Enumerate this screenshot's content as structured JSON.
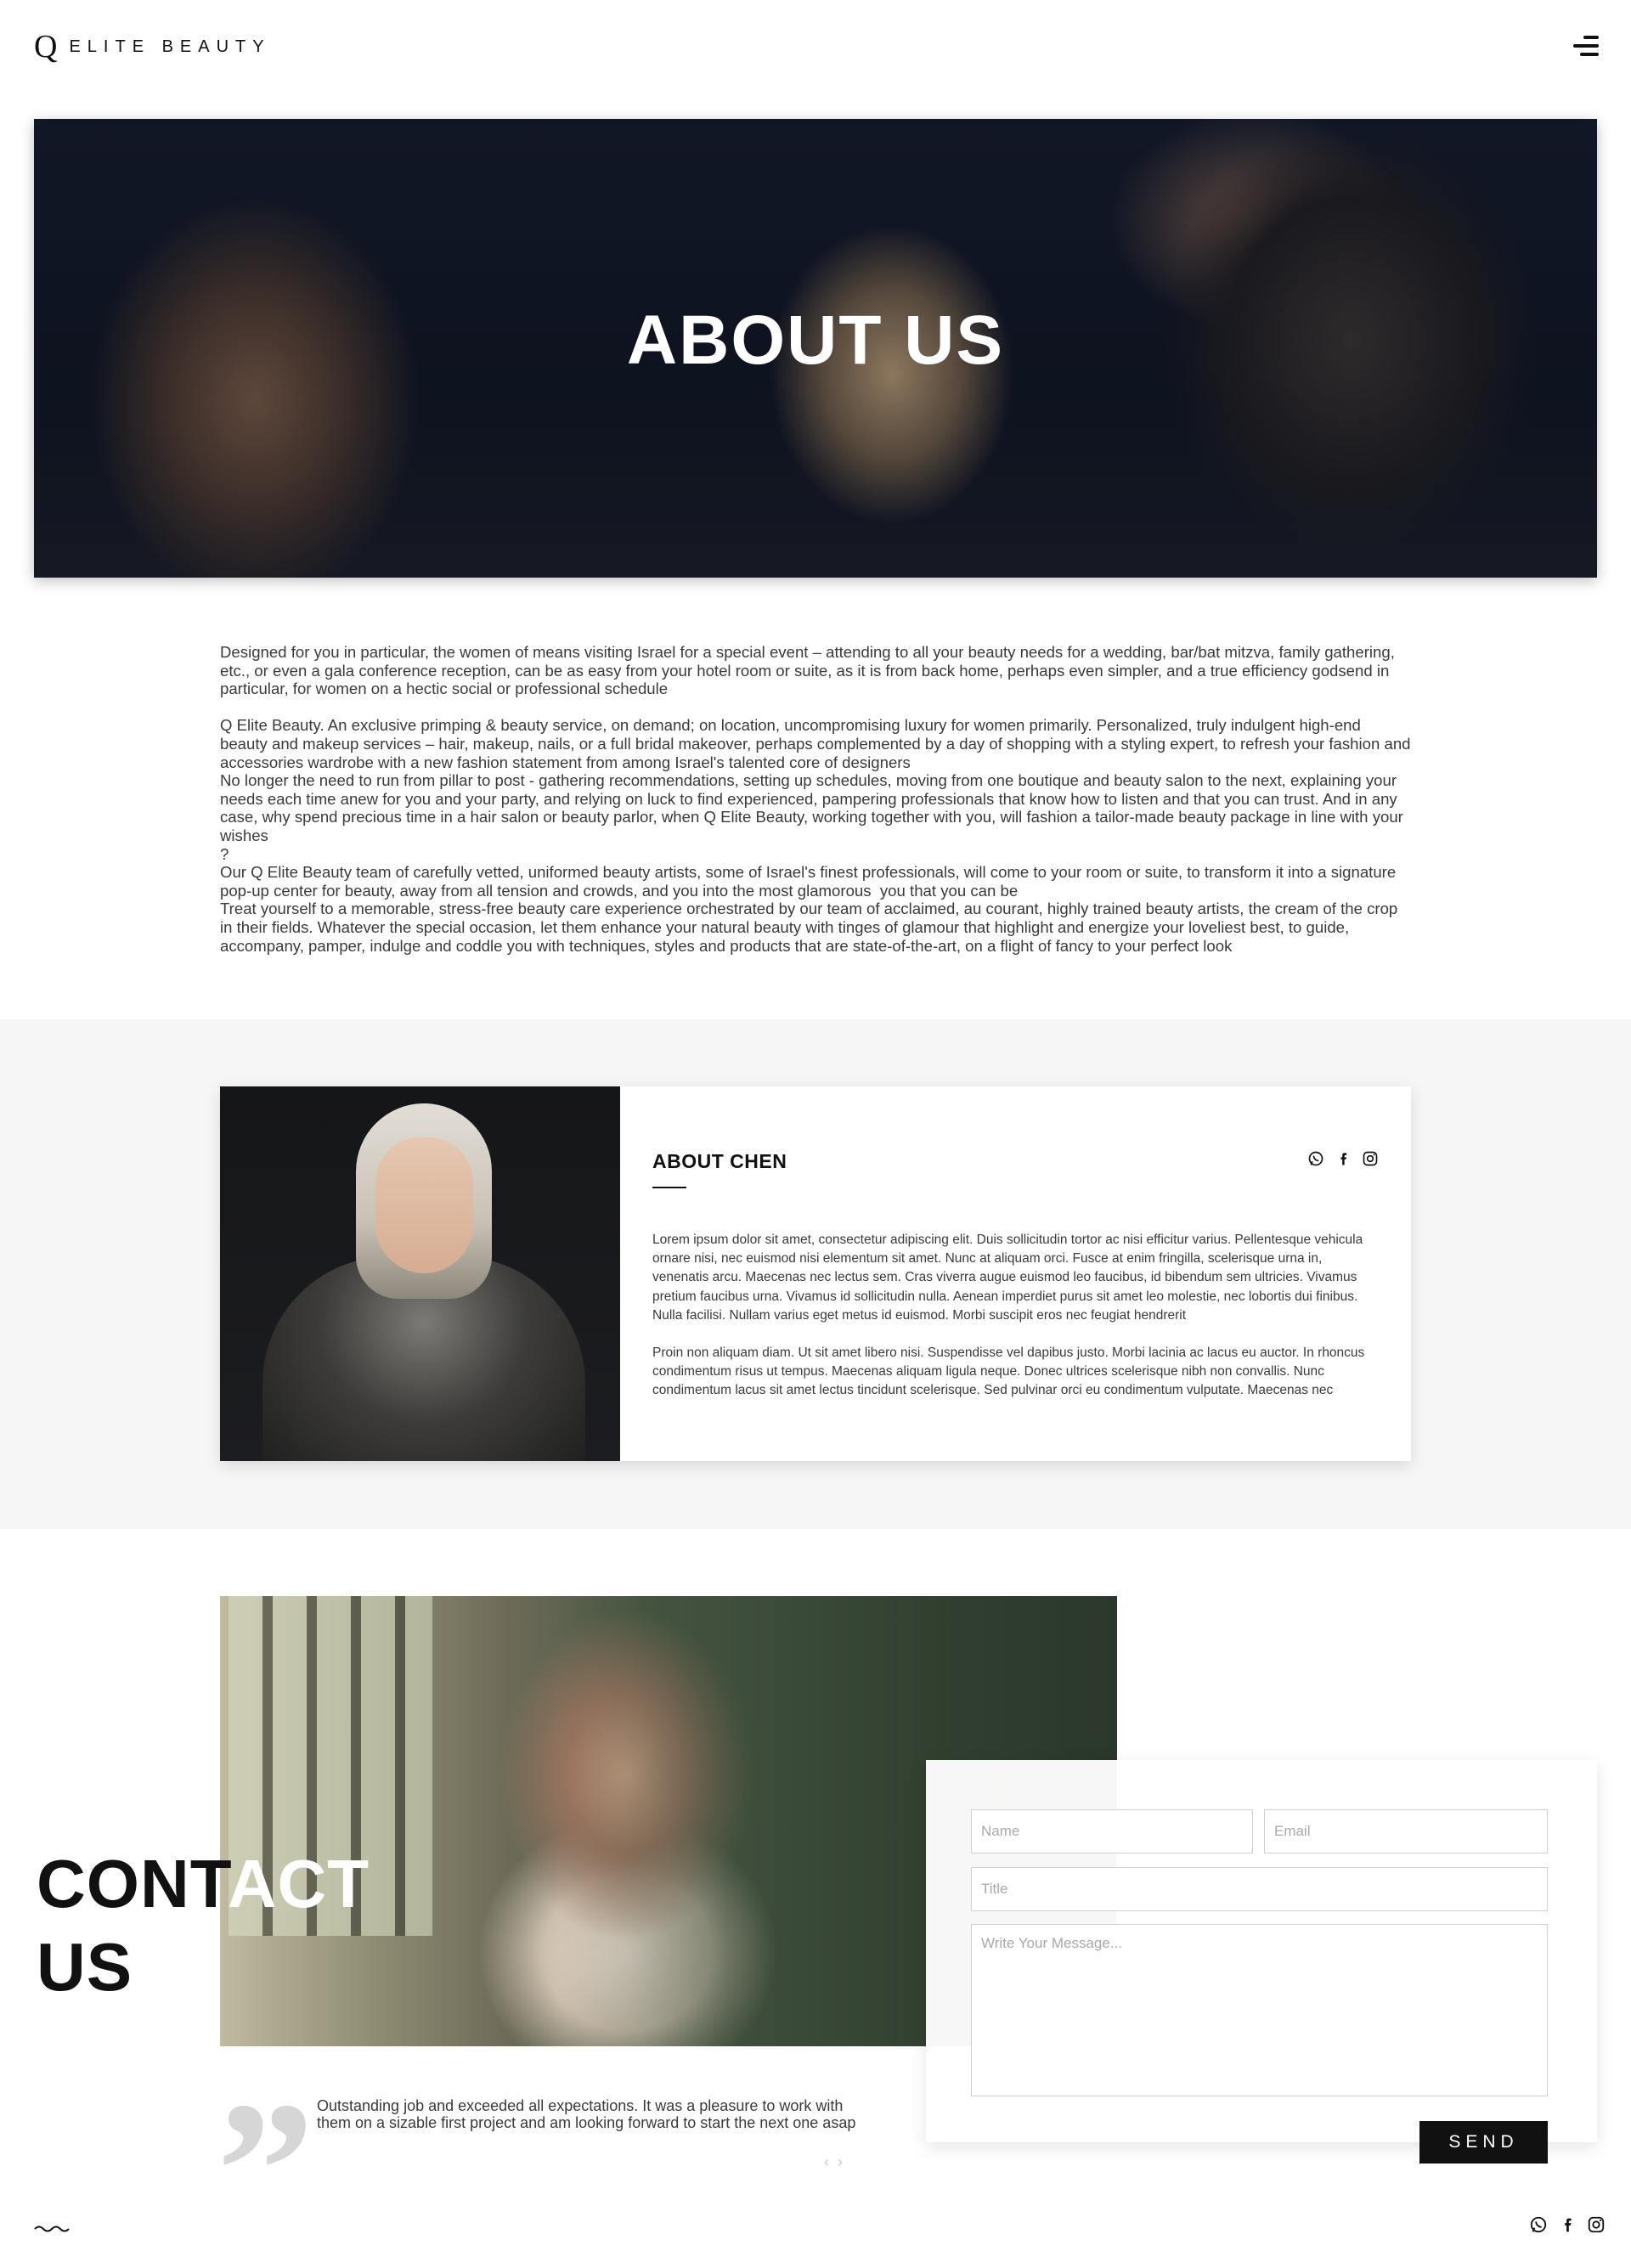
{
  "header": {
    "logo_mark": "Q",
    "logo_text": "ELITE BEAUTY",
    "menu_icon": "hamburger-menu-icon"
  },
  "hero": {
    "title": "ABOUT US"
  },
  "intro": {
    "paragraphs": [
      "Designed for you in particular, the women of means visiting Israel for a special event – attending to all your beauty needs for a wedding, bar/bat mitzva, family gathering, etc., or even a gala conference reception, can be as easy from your hotel room or suite, as it is from back home, perhaps even simpler, and a true efficiency godsend in particular, for women on a hectic social or professional schedule",
      "",
      "Q Elite Beauty. An exclusive primping & beauty service, on demand; on location, uncompromising luxury for women primarily. Personalized, truly indulgent high-end beauty and makeup services – hair, makeup, nails, or a full bridal makeover, perhaps complemented by a day of shopping with a styling expert, to refresh your fashion and accessories wardrobe with a new fashion statement from among Israel's talented core of designers",
      "No longer the need to run from pillar to post - gathering recommendations, setting up schedules, moving from one boutique and beauty salon to the next, explaining your needs each time anew for you and your party, and relying on luck to find experienced, pampering professionals that know how to listen and that you can trust. And in any case, why spend precious time in a hair salon or beauty parlor, when Q Elite Beauty, working together with you, will fashion a tailor-made beauty package in line with your wishes",
      "?",
      "Our Q Elite Beauty team of carefully vetted, uniformed beauty artists, some of Israel's finest professionals, will come to your room or suite, to transform it into a signature pop-up center for beauty, away from all tension and crowds, and you into the most glamorous  you that you can be",
      "Treat yourself to a memorable, stress-free beauty care experience orchestrated by our team of acclaimed, au courant, highly trained beauty artists, the cream of the crop in their fields. Whatever the special occasion, let them enhance your natural beauty with tinges of glamour that highlight and energize your loveliest best, to guide, accompany, pamper, indulge and coddle you with techniques, styles and products that are state-of-the-art, on a flight of fancy to your perfect look"
    ]
  },
  "about_chen": {
    "title": "ABOUT CHEN",
    "social_icons": [
      "whatsapp-icon",
      "facebook-icon",
      "instagram-icon"
    ],
    "paragraphs": [
      "Lorem ipsum dolor sit amet, consectetur adipiscing elit. Duis sollicitudin tortor ac nisi efficitur varius. Pellentesque vehicula ornare nisi, nec euismod nisi elementum sit amet. Nunc at aliquam orci. Fusce at enim fringilla, scelerisque urna in, venenatis arcu. Maecenas nec lectus sem. Cras viverra augue euismod leo faucibus, id bibendum sem ultricies. Vivamus pretium faucibus urna. Vivamus id sollicitudin nulla. Aenean imperdiet purus sit amet leo molestie, nec lobortis dui finibus. Nulla facilisi. Nullam varius eget metus id euismod. Morbi suscipit eros nec feugiat hendrerit",
      "Proin non aliquam diam. Ut sit amet libero nisi. Suspendisse vel dapibus justo. Morbi lacinia ac lacus eu auctor. In rhoncus condimentum risus ut tempus. Maecenas aliquam ligula neque. Donec ultrices scelerisque nibh non convallis. Nunc condimentum lacus sit amet lectus tincidunt scelerisque. Sed pulvinar orci eu condimentum vulputate. Maecenas nec"
    ]
  },
  "contact": {
    "heading_line1_dark": "CONT",
    "heading_line1_light": "ACT",
    "heading_line2": "US",
    "form": {
      "name_placeholder": "Name",
      "email_placeholder": "Email",
      "title_placeholder": "Title",
      "message_placeholder": "Write Your Message...",
      "send_label": "SEND"
    },
    "testimonial": {
      "text": "Outstanding job and exceeded all expectations. It was a pleasure to work with them on a sizable first project and am looking forward to start the next one asap",
      "prev_icon": "chevron-left-icon",
      "next_icon": "chevron-right-icon"
    }
  },
  "footer": {
    "wave_icon": "wave-icon",
    "social_icons": [
      "whatsapp-icon",
      "facebook-icon",
      "instagram-icon"
    ]
  },
  "colors": {
    "text": "#3a3a3a",
    "dark": "#111111",
    "band": "#f6f6f6",
    "button": "#111111"
  }
}
